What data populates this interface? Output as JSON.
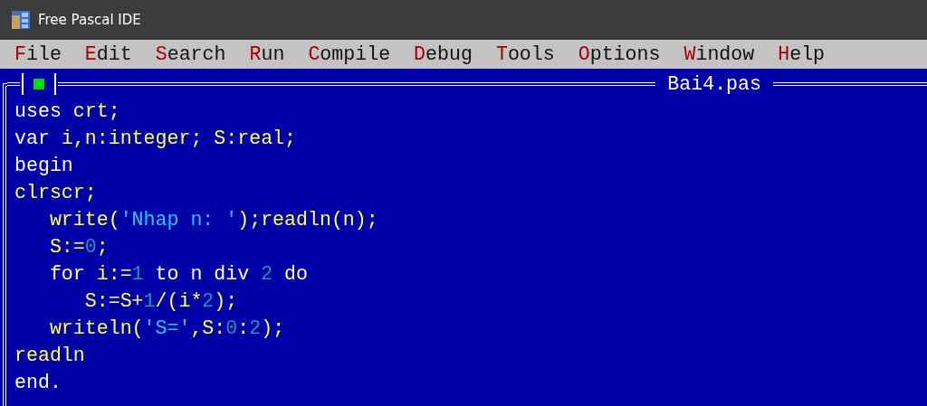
{
  "window": {
    "title": "Free Pascal IDE"
  },
  "menu": [
    {
      "hotkey": "F",
      "rest": "ile"
    },
    {
      "hotkey": "E",
      "rest": "dit"
    },
    {
      "hotkey": "S",
      "rest": "earch"
    },
    {
      "hotkey": "R",
      "rest": "un"
    },
    {
      "hotkey": "C",
      "rest": "ompile"
    },
    {
      "hotkey": "D",
      "rest": "ebug"
    },
    {
      "hotkey": "T",
      "rest": "ools"
    },
    {
      "hotkey": "O",
      "rest": "ptions"
    },
    {
      "hotkey": "W",
      "rest": "indow"
    },
    {
      "hotkey": "H",
      "rest": "elp"
    }
  ],
  "editor": {
    "title": "Bai4.pas",
    "lines": [
      [
        {
          "text": "uses ",
          "kind": "keyword"
        },
        {
          "text": "crt;",
          "kind": "identifier"
        }
      ],
      [
        {
          "text": "var ",
          "kind": "keyword"
        },
        {
          "text": "i,n:integer; S:real;",
          "kind": "identifier"
        }
      ],
      [
        {
          "text": "begin",
          "kind": "keyword"
        }
      ],
      [
        {
          "text": "clrscr;",
          "kind": "identifier"
        }
      ],
      [
        {
          "text": "   write(",
          "kind": "identifier"
        },
        {
          "text": "'Nhap n: '",
          "kind": "string"
        },
        {
          "text": ");readln(n);",
          "kind": "identifier"
        }
      ],
      [
        {
          "text": "   S:=",
          "kind": "identifier"
        },
        {
          "text": "0",
          "kind": "number"
        },
        {
          "text": ";",
          "kind": "identifier"
        }
      ],
      [
        {
          "text": "   for ",
          "kind": "keyword"
        },
        {
          "text": "i:=",
          "kind": "identifier"
        },
        {
          "text": "1",
          "kind": "number"
        },
        {
          "text": " to n div ",
          "kind": "keyword"
        },
        {
          "text": "2",
          "kind": "number"
        },
        {
          "text": " do",
          "kind": "keyword"
        }
      ],
      [
        {
          "text": "      S:=S+",
          "kind": "identifier"
        },
        {
          "text": "1",
          "kind": "number"
        },
        {
          "text": "/(i*",
          "kind": "identifier"
        },
        {
          "text": "2",
          "kind": "number"
        },
        {
          "text": ");",
          "kind": "identifier"
        }
      ],
      [
        {
          "text": "   writeln(",
          "kind": "identifier"
        },
        {
          "text": "'S='",
          "kind": "string"
        },
        {
          "text": ",S:",
          "kind": "identifier"
        },
        {
          "text": "0",
          "kind": "number"
        },
        {
          "text": ":",
          "kind": "identifier"
        },
        {
          "text": "2",
          "kind": "number"
        },
        {
          "text": ");",
          "kind": "identifier"
        }
      ],
      [
        {
          "text": "readln",
          "kind": "identifier"
        }
      ],
      [
        {
          "text": "end",
          "kind": "keyword"
        },
        {
          "text": ".",
          "kind": "identifier"
        }
      ]
    ]
  }
}
